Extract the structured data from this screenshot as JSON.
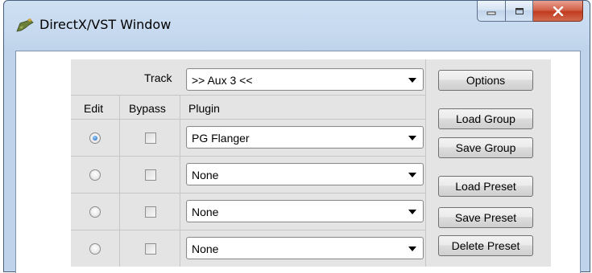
{
  "window": {
    "title": "DirectX/VST Window",
    "controls": {
      "minimize": "minimize",
      "maximize": "maximize",
      "close": "close"
    }
  },
  "track": {
    "label": "Track",
    "selected": ">> Aux 3 <<"
  },
  "columns": {
    "edit": "Edit",
    "bypass": "Bypass",
    "plugin": "Plugin"
  },
  "slots": [
    {
      "edit_selected": true,
      "bypass": false,
      "plugin": "PG Flanger"
    },
    {
      "edit_selected": false,
      "bypass": false,
      "plugin": "None"
    },
    {
      "edit_selected": false,
      "bypass": false,
      "plugin": "None"
    },
    {
      "edit_selected": false,
      "bypass": false,
      "plugin": "None"
    }
  ],
  "buttons": {
    "options": "Options",
    "load_group": "Load Group",
    "save_group": "Save Group",
    "load_preset": "Load Preset",
    "save_preset": "Save Preset",
    "delete_preset": "Delete Preset"
  },
  "colors": {
    "titlebar": "#c6d9ef",
    "panel": "#e4e4e4",
    "close_button": "#c13b1f",
    "radio_selected": "#1d5fb3"
  }
}
